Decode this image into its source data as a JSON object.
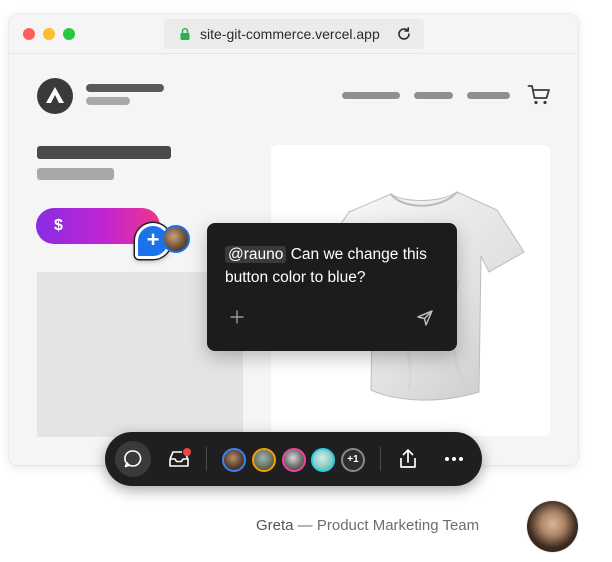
{
  "browser": {
    "url": "site-git-commerce.vercel.app",
    "icons": {
      "lock": "lock-icon",
      "reload": "reload-icon"
    }
  },
  "store": {
    "buy_button_label": "$",
    "icons": {
      "logo": "vercel-triangle-logo",
      "cart": "cart-icon"
    },
    "colors": {
      "buy_gradient_start": "#8a2be2",
      "buy_gradient_end": "#f0348c"
    }
  },
  "comment": {
    "mention": "@rauno",
    "text": " Can we change this button color to blue?",
    "icons": {
      "add": "plus-icon",
      "send": "send-icon"
    },
    "pin_label": "+"
  },
  "toolbar": {
    "more_collaborators_label": "+1",
    "icons": [
      "comment-icon",
      "inbox-icon",
      "share-icon",
      "more-icon"
    ],
    "avatar_ring_colors": [
      "#3b82f6",
      "#f59e0b",
      "#ec4899",
      "#22d3ee",
      "#8a8a8a"
    ],
    "inbox_badge_color": "#ef4444"
  },
  "attribution": {
    "name": "Greta",
    "team": " — Product Marketing Team"
  }
}
